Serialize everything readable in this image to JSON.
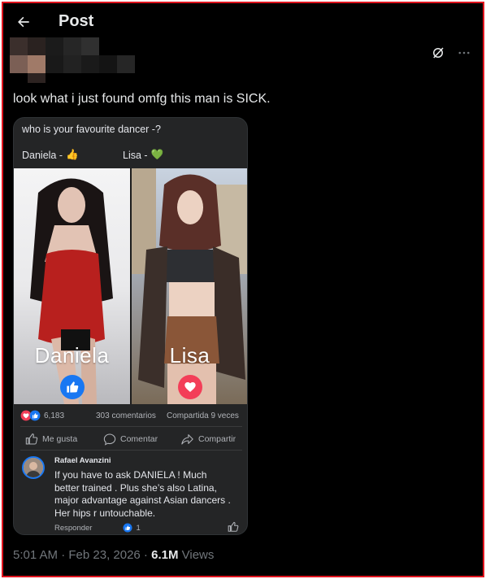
{
  "header": {
    "title": "Post"
  },
  "post": {
    "text": "look what i just found omfg this man is SICK.",
    "timestamp": "5:01 AM · Feb 23, 2026 · ",
    "views_count": "6.1M",
    "views_label": " Views"
  },
  "card": {
    "question": "who is your favourite dancer -?",
    "option_left": "Daniela - ",
    "option_left_emoji": "👍",
    "option_right": "Lisa - ",
    "option_right_emoji": "💚",
    "left_name": "Daniela",
    "right_name": "Lisa",
    "reaction_count": "6,183",
    "comments": "303 comentarios",
    "shares": "Compartida 9 veces",
    "like_label": "Me gusta",
    "comment_label": "Comentar",
    "share_label": "Compartir",
    "comment_author": "Rafael Avanzini",
    "comment_text": "If you have to ask DANIELA ! Much better trained . Plus she’s also Latina, major advantage against Asian dancers . Her hips r untouchable.",
    "reply_label": "Responder",
    "comment_likes": "1"
  },
  "colors": {
    "background": "#000000",
    "text": "#e7e9ea",
    "muted": "#71767b",
    "fb_blue": "#1877f2",
    "fb_red": "#f33e58"
  }
}
